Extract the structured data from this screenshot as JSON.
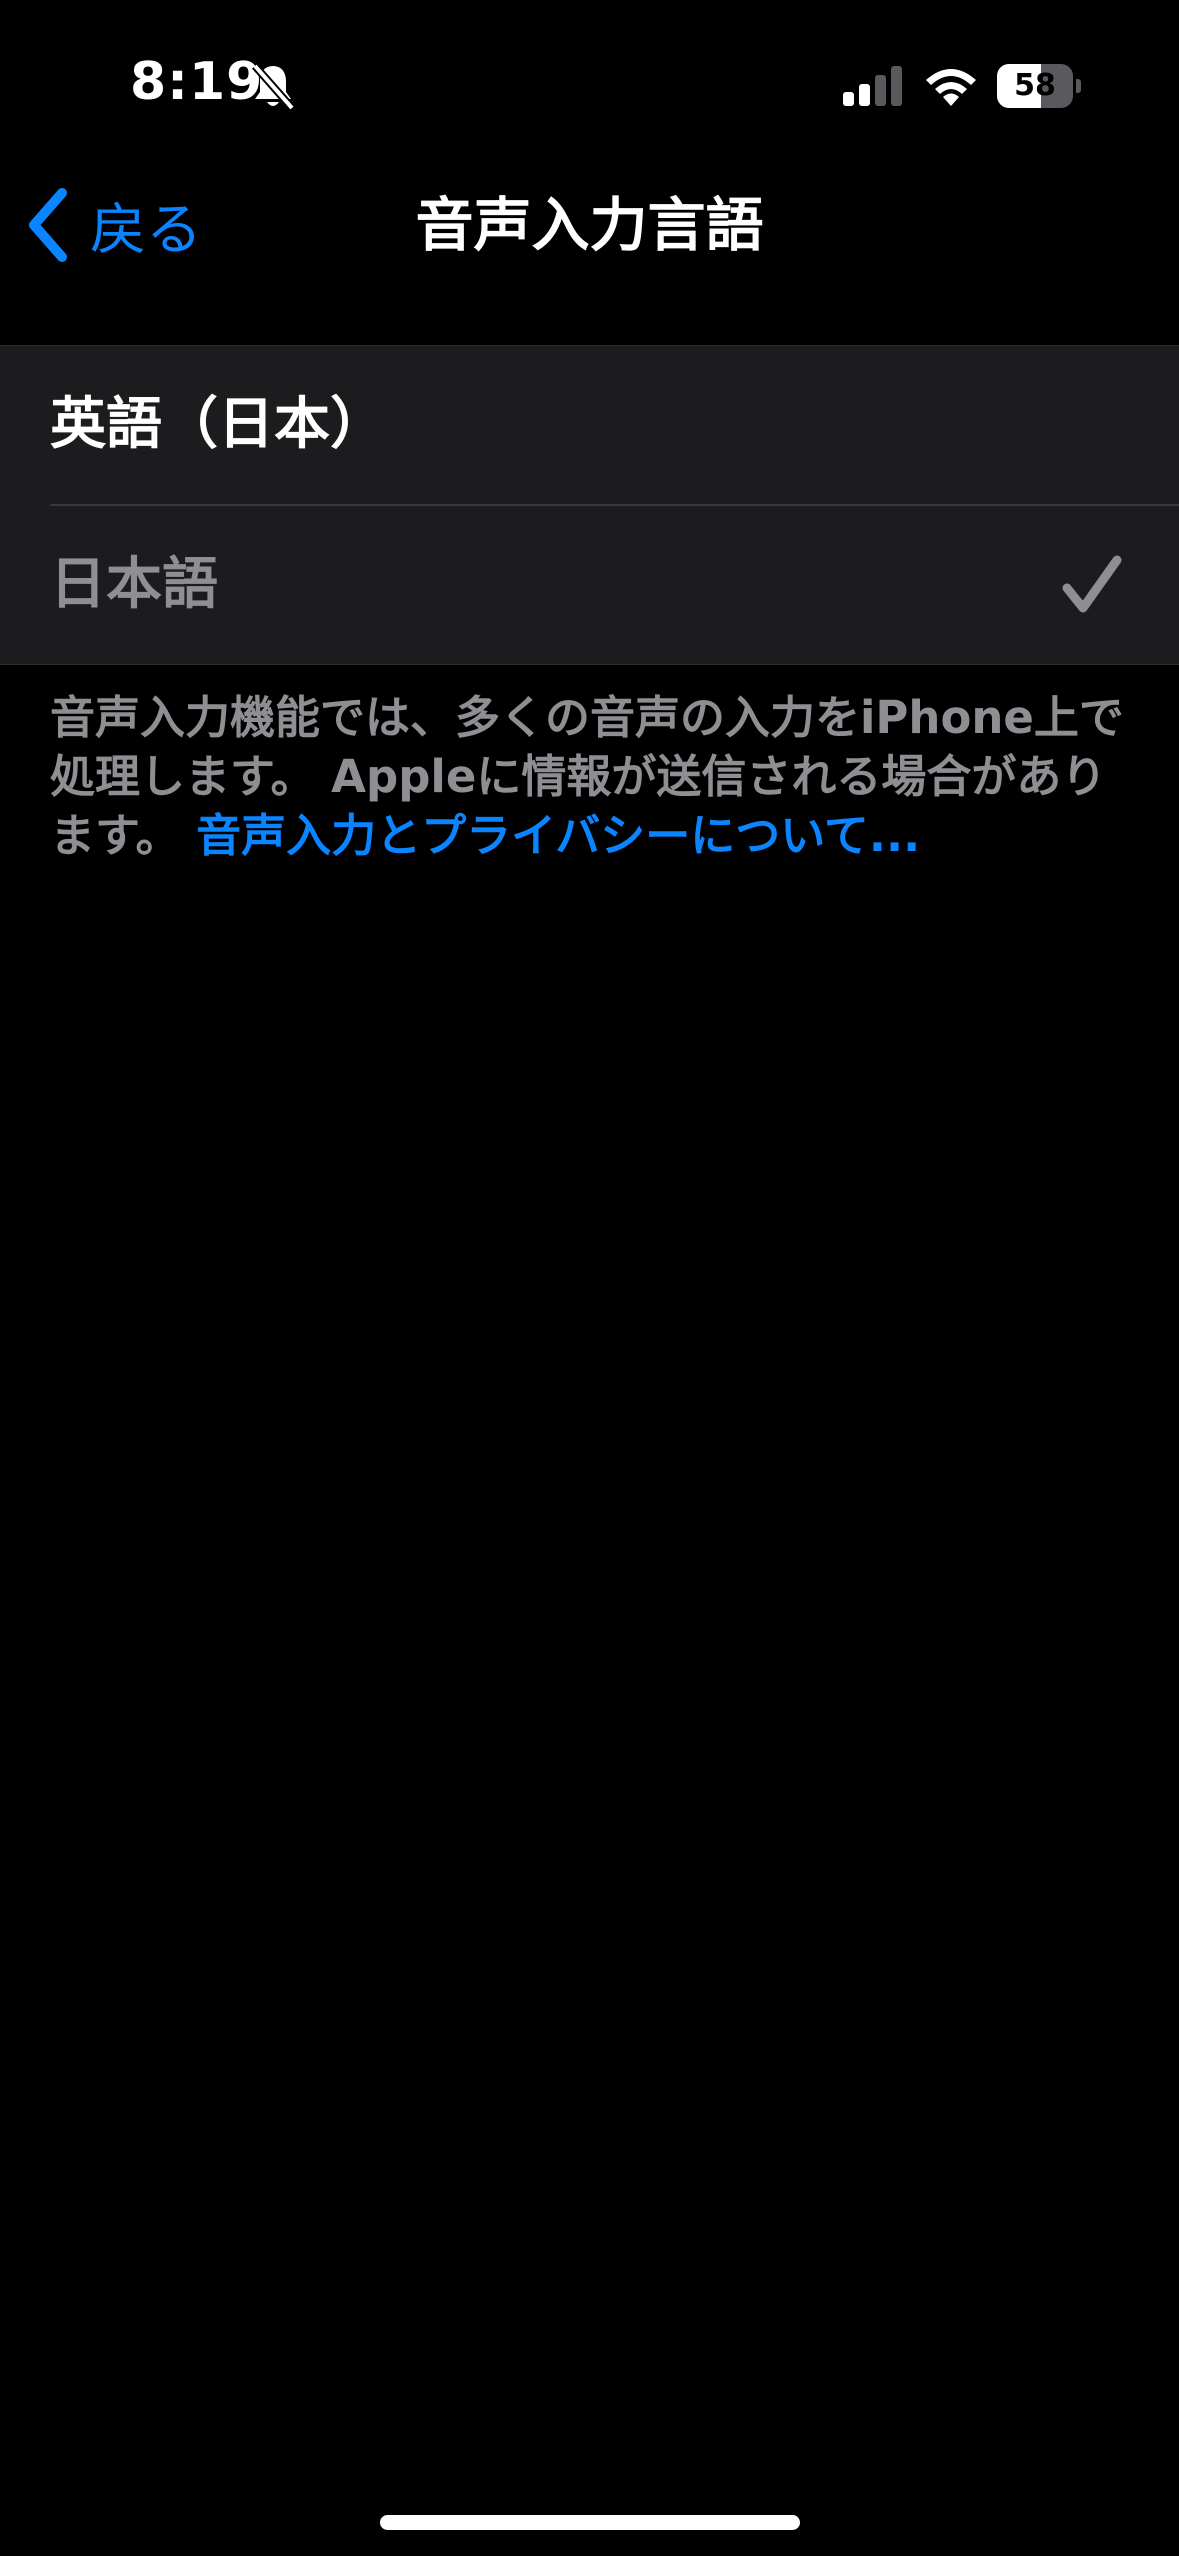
{
  "status_bar": {
    "time": "8:19",
    "battery_level": "58",
    "battery_fraction": 0.58,
    "icons": [
      "bell-slash-icon",
      "cellular-signal-icon",
      "wifi-icon",
      "battery-icon"
    ]
  },
  "nav": {
    "back_label": "戻る",
    "title": "音声入力言語"
  },
  "languages": [
    {
      "label": "英語（日本）",
      "selected": false
    },
    {
      "label": "日本語",
      "selected": true
    }
  ],
  "footer": {
    "description": "音声入力機能では、多くの音声の入力をiPhone上で処理します。 Appleに情報が送信される場合があります。 ",
    "link": "音声入力とプライバシーについて..."
  },
  "colors": {
    "background": "#000000",
    "group_background": "#1c1c1e",
    "accent": "#0a84ff",
    "secondary_text": "#8e8e93"
  }
}
